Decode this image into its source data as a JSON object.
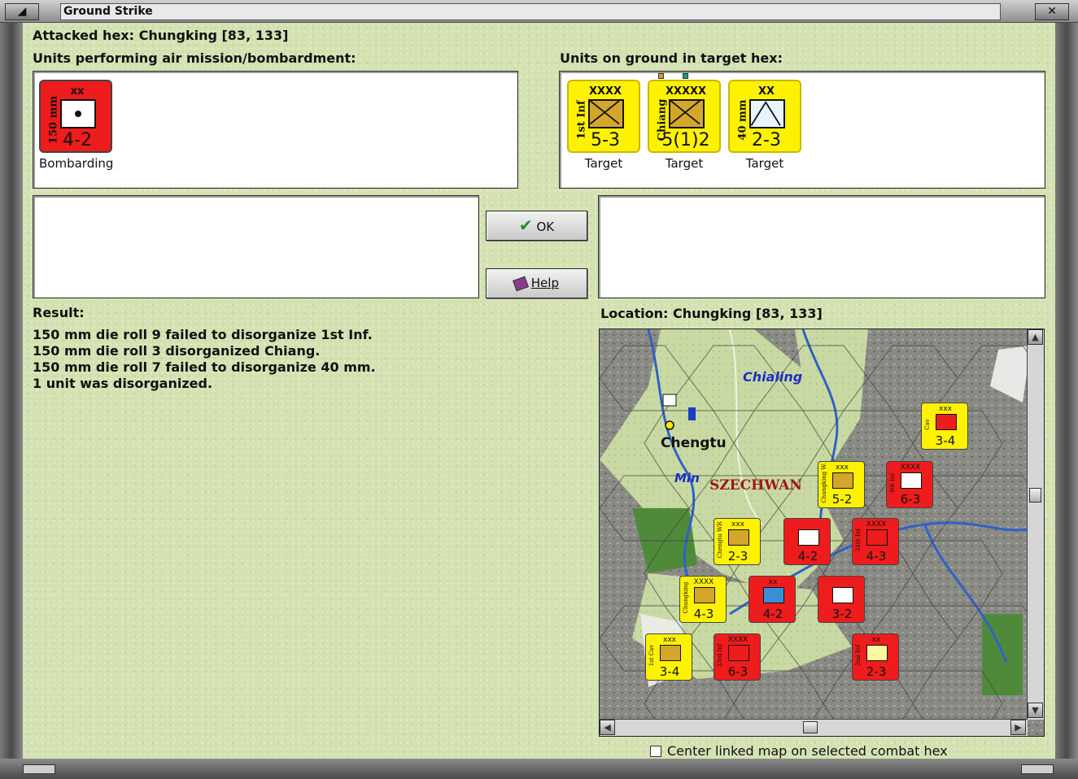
{
  "window": {
    "title": "Ground Strike"
  },
  "header": {
    "attacked_hex": "Attacked hex: Chungking  [83, 133]",
    "air_units_label": "Units performing air mission/bombardment:",
    "ground_units_label": "Units on ground in target hex:"
  },
  "air_units": [
    {
      "size": "xx",
      "side": "150 mm",
      "values": "4-2",
      "status": "Bombarding",
      "color": "#ee1c1c"
    }
  ],
  "ground_units": [
    {
      "size": "XXXX",
      "side": "1st Inf",
      "values": "5-3",
      "status": "Target",
      "color": "#fff200"
    },
    {
      "size": "XXXXX",
      "side": "Chiang",
      "values": "5(1)2",
      "status": "Target",
      "color": "#fff200"
    },
    {
      "size": "XX",
      "side": "40 mm",
      "values": "2-3",
      "status": "Target",
      "color": "#fff200"
    }
  ],
  "buttons": {
    "ok": "OK",
    "help": "Help"
  },
  "result": {
    "label": "Result:",
    "lines": [
      "150 mm die roll 9 failed to disorganize 1st Inf.",
      "150 mm die roll 3 disorganized Chiang.",
      "150 mm die roll 7 failed to disorganize 40 mm.",
      "1 unit was disorganized."
    ]
  },
  "location": {
    "label": "Location:  Chungking  [83, 133]"
  },
  "map": {
    "labels": {
      "chialing": "Chialing",
      "chengtu": "Chengtu",
      "min": "Min",
      "szechwan": "SZECHWAN"
    },
    "counters": [
      {
        "id": "m1",
        "color": "#fff200",
        "size": "xxx",
        "side": "Cav",
        "values": "3-4",
        "box": "red"
      },
      {
        "id": "m2",
        "color": "#fff200",
        "size": "xxx",
        "side": "Chungking W.",
        "values": "5-2",
        "box": "tan"
      },
      {
        "id": "m3",
        "color": "#ee1c1c",
        "size": "XXXX",
        "side": "4th Inf",
        "values": "6-3",
        "box": "white"
      },
      {
        "id": "m4",
        "color": "#fff200",
        "size": "xxx",
        "side": "Chengtu WR",
        "values": "2-3",
        "box": "tan"
      },
      {
        "id": "m5",
        "color": "#ee1c1c",
        "size": "",
        "side": "",
        "values": "4-2",
        "box": "white"
      },
      {
        "id": "m6",
        "color": "#ee1c1c",
        "size": "XXXX",
        "side": "24th Inf",
        "values": "4-3",
        "box": "red"
      },
      {
        "id": "m7",
        "color": "#fff200",
        "size": "XXXX",
        "side": "Chungking",
        "values": "4-3",
        "box": "tan"
      },
      {
        "id": "m8",
        "color": "#ee1c1c",
        "size": "xx",
        "side": "",
        "values": "4-2",
        "box": "blue"
      },
      {
        "id": "m9",
        "color": "#ee1c1c",
        "size": "",
        "side": "",
        "values": "3-2",
        "box": "white"
      },
      {
        "id": "m10",
        "color": "#fff200",
        "size": "xxx",
        "side": "1st Cav",
        "values": "3-4",
        "box": "tan"
      },
      {
        "id": "m11",
        "color": "#ee1c1c",
        "size": "XXXX",
        "side": "23rd Inf",
        "values": "6-3",
        "box": "red"
      },
      {
        "id": "m12",
        "color": "#ee1c1c",
        "size": "xx",
        "side": "2nd Inf",
        "values": "2-3",
        "box": "yellow"
      }
    ]
  },
  "footer": {
    "center_linked_map": "Center linked map on selected combat hex"
  }
}
